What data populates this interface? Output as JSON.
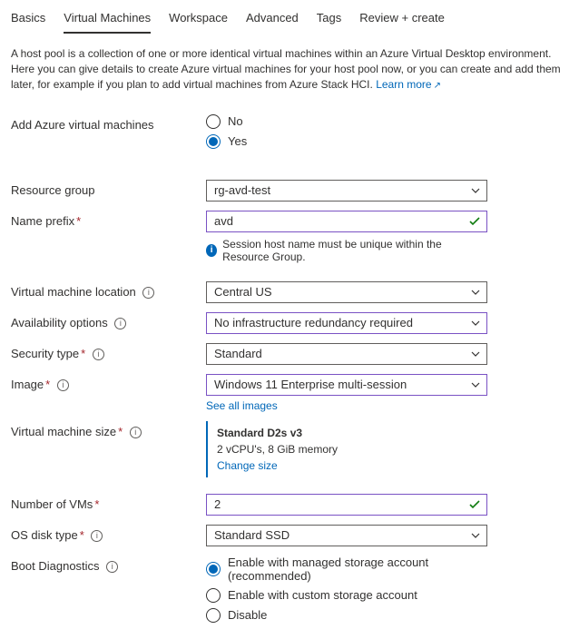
{
  "tabs": {
    "basics": "Basics",
    "vms": "Virtual Machines",
    "workspace": "Workspace",
    "advanced": "Advanced",
    "tags": "Tags",
    "review": "Review + create"
  },
  "intro": {
    "text": "A host pool is a collection of one or more identical virtual machines within an Azure Virtual Desktop environment. Here you can give details to create Azure virtual machines for your host pool now, or you can create and add them later, for example if you plan to add virtual machines from Azure Stack HCI. ",
    "link": "Learn more"
  },
  "labels": {
    "add_vm": "Add Azure virtual machines",
    "resource_group": "Resource group",
    "name_prefix": "Name prefix",
    "vm_location": "Virtual machine location",
    "availability": "Availability options",
    "security": "Security type",
    "image": "Image",
    "vm_size": "Virtual machine size",
    "num_vms": "Number of VMs",
    "os_disk": "OS disk type",
    "boot_diag": "Boot Diagnostics"
  },
  "add_vm": {
    "no": "No",
    "yes": "Yes",
    "selected": "yes"
  },
  "resource_group": {
    "value": "rg-avd-test"
  },
  "name_prefix": {
    "value": "avd",
    "helper": "Session host name must be unique within the Resource Group."
  },
  "vm_location": {
    "value": "Central US"
  },
  "availability": {
    "value": "No infrastructure redundancy required"
  },
  "security": {
    "value": "Standard"
  },
  "image": {
    "value": "Windows 11 Enterprise multi-session",
    "link": "See all images"
  },
  "vm_size": {
    "name": "Standard D2s v3",
    "specs": "2 vCPU's, 8 GiB memory",
    "link": "Change size"
  },
  "num_vms": {
    "value": "2"
  },
  "os_disk": {
    "value": "Standard SSD"
  },
  "boot_diag": {
    "opt1": "Enable with managed storage account (recommended)",
    "opt2": "Enable with custom storage account",
    "opt3": "Disable",
    "selected": "opt1"
  }
}
